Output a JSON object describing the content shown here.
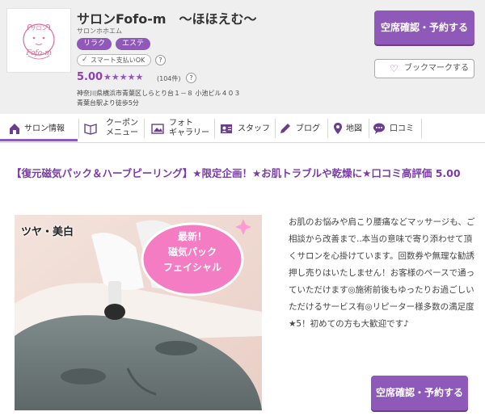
{
  "salon": {
    "logo_top": "サロン",
    "logo_text": "Fofo-m",
    "name": "サロンFofo-m　～ほほえむ～",
    "kana": "サロンホホエム",
    "tags": [
      "リラク",
      "エステ"
    ],
    "payment_badge": "スマート支払いOK",
    "help_mark": "?",
    "rating": "5.00",
    "stars": "★★★★★",
    "review_count": "(104件)",
    "address": "神奈川県横浜市青葉区しらとり台１－８ 小池ビル４０３",
    "access": "青葉台駅より徒歩5分"
  },
  "buttons": {
    "reserve_top": "空席確認・予約する",
    "bookmark": "ブックマークする",
    "reserve_bottom": "空席確認・予約する"
  },
  "nav": {
    "items": [
      {
        "label": "サロン情報",
        "icon": "home-icon",
        "active": true
      },
      {
        "label_1": "クーポン",
        "label_2": "メニュー",
        "icon": "coupon-icon"
      },
      {
        "label_1": "フォト",
        "label_2": "ギャラリー",
        "icon": "photo-icon"
      },
      {
        "label": "スタッフ",
        "icon": "staff-card-icon"
      },
      {
        "label": "ブログ",
        "icon": "pencil-icon"
      },
      {
        "label": "地図",
        "icon": "map-pin-icon"
      },
      {
        "label": "口コミ",
        "icon": "speech-bubble-icon"
      }
    ]
  },
  "main": {
    "headline": "【復元磁気パック＆ハーブピーリング】★限定企画！★お肌トラブルや乾燥に★口コミ高評価 5.00",
    "photo": {
      "corner_text": "ツヤ・美白",
      "bubble_line1": "最新！",
      "bubble_line2": "磁気パック",
      "bubble_line3": "フェイシャル"
    },
    "description": "お肌のお悩みや肩こり腰痛などマッサージも、ご相談から改善まで..本当の意味で寄り添わせて頂くサロンを心掛けています。回数券や無理な勧誘押し売りはいたしません！お客様のペースで通っていただけます◎施術前後もゆったりお過ごしいただけるサービス有◎リピーター様多数の満足度★5！初めての方も大歓迎です♪"
  },
  "colors": {
    "accent": "#8e59b8",
    "accent_dark": "#6a3d8e",
    "headline": "#7a3aa8",
    "header_bg": "#efefef"
  }
}
